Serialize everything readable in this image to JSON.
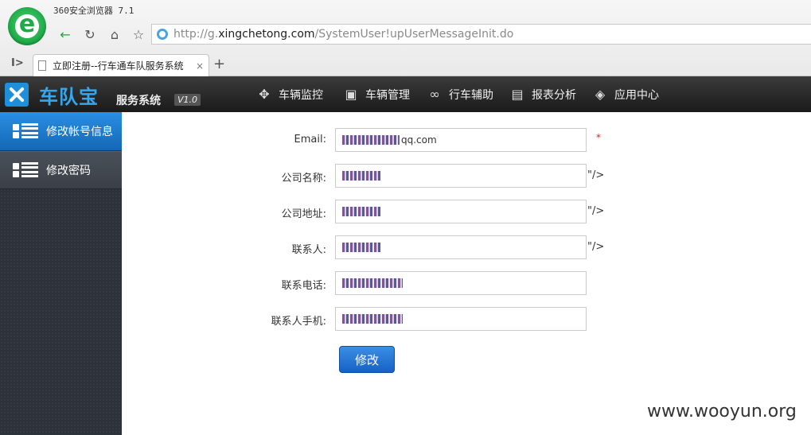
{
  "browser": {
    "title": "360安全浏览器 7.1",
    "url_prefix": "http://g.",
    "url_domain": "xingchetong.com",
    "url_path": "/SystemUser!upUserMessageInit.do",
    "tab_title": "立即注册--行车通车队服务系统",
    "tab_close": "×",
    "new_tab": "+",
    "sidebar_toggle": "I>"
  },
  "app": {
    "brand": "车队宝",
    "subtitle": "服务系统",
    "version": "V1.0",
    "menu": [
      {
        "label": "车辆监控",
        "icon": "move-arrows-icon"
      },
      {
        "label": "车辆管理",
        "icon": "truck-icon"
      },
      {
        "label": "行车辅助",
        "icon": "link-icon"
      },
      {
        "label": "报表分析",
        "icon": "report-icon"
      },
      {
        "label": "应用中心",
        "icon": "puzzle-icon"
      }
    ]
  },
  "sidebar": {
    "items": [
      {
        "label": "修改帐号信息",
        "active": true
      },
      {
        "label": "修改密码",
        "active": false
      }
    ]
  },
  "form": {
    "email": {
      "label": "Email:",
      "value_suffix": "qq.com",
      "required_mark": "*"
    },
    "company_name": {
      "label": "公司名称:",
      "after": "\"/>"
    },
    "company_address": {
      "label": "公司地址:",
      "after": "\"/>"
    },
    "contact": {
      "label": "联系人:",
      "after": "\"/>"
    },
    "phone": {
      "label": "联系电话:"
    },
    "mobile": {
      "label": "联系人手机:"
    },
    "submit_label": "修改"
  },
  "watermark": "www.wooyun.org"
}
